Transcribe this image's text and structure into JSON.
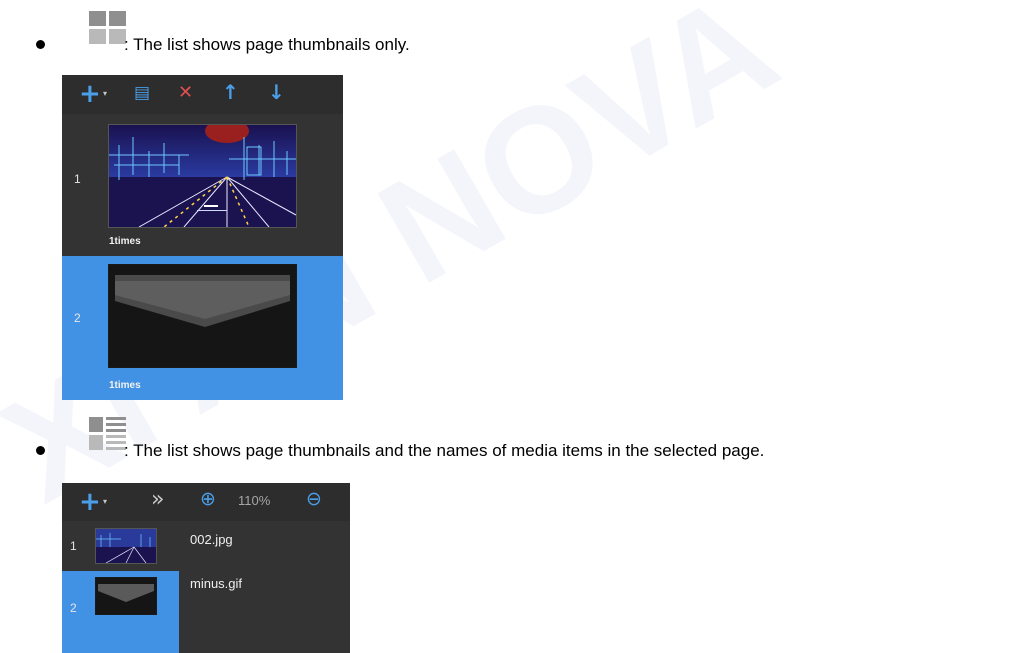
{
  "watermark": "XI'AN NOVA",
  "sections": [
    {
      "icon": "grid-view-icon",
      "text": ": The list shows page thumbnails only.",
      "toolbar": {
        "add": "+",
        "add_caret": "▾",
        "copy": "▤",
        "delete": "✕",
        "up": "↑",
        "down": "↓",
        "add_icon": "plus-icon",
        "copy_icon": "copy-page-icon",
        "delete_icon": "delete-icon",
        "up_icon": "arrow-up-icon",
        "down_icon": "arrow-down-icon"
      },
      "pages": [
        {
          "number": "1",
          "play_times": "1times",
          "selected": false
        },
        {
          "number": "2",
          "play_times": "1times",
          "selected": true
        }
      ]
    },
    {
      "icon": "list-view-icon",
      "text": ": The list shows page thumbnails and the names of media items in the selected page.",
      "toolbar": {
        "add": "+",
        "add_caret": "▾",
        "expand": "»",
        "zoom_in": "⊕",
        "zoom_level": "110%",
        "zoom_out": "⊖",
        "zoom_in_icon": "zoom-in-icon",
        "zoom_out_icon": "zoom-out-icon"
      },
      "pages": [
        {
          "number": "1",
          "selected": false
        },
        {
          "number": "2",
          "selected": true
        }
      ],
      "media_items": [
        "002.jpg",
        "minus.gif"
      ]
    }
  ],
  "colors": {
    "panel_bg": "#333333",
    "toolbar_bg": "#2d2d2d",
    "selected_row": "#4191e4",
    "accent_blue": "#4a9fe8",
    "delete_red": "#e05050"
  }
}
